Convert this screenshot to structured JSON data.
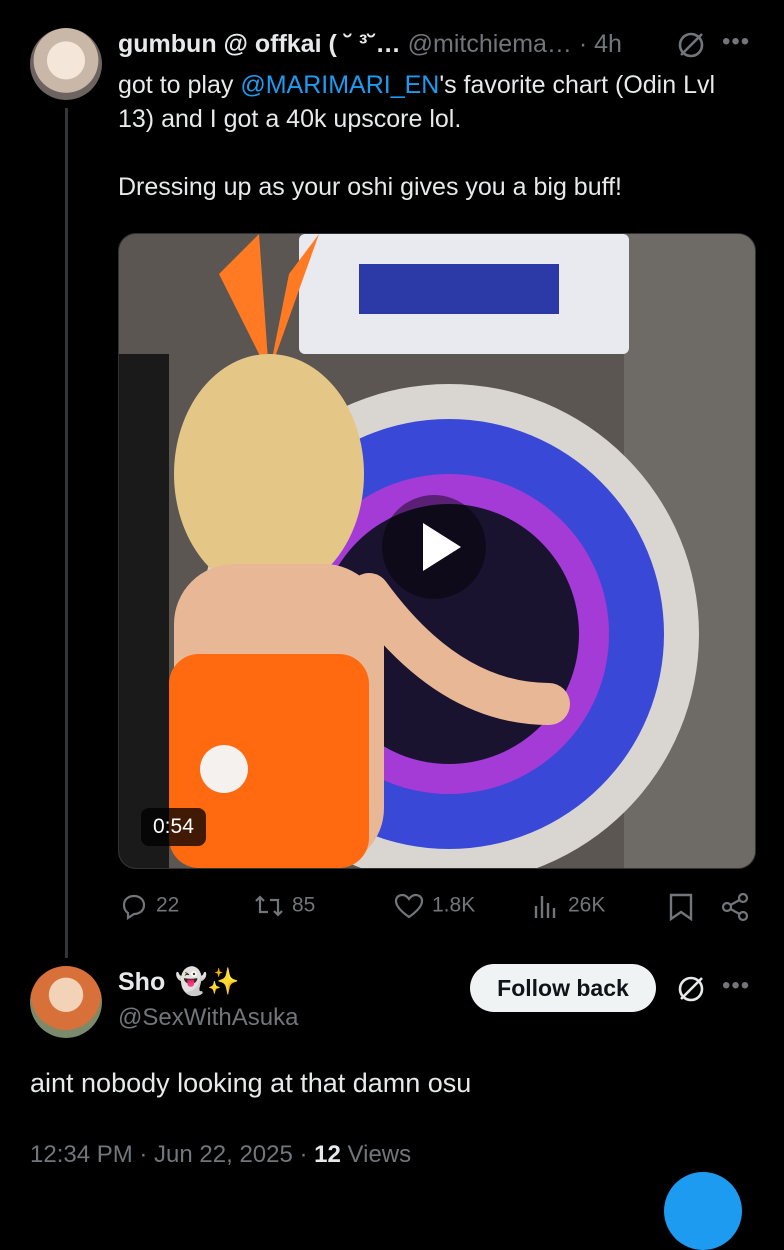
{
  "tweet": {
    "author_name": "gumbun @ offkai ( ˘ ³˘…",
    "handle": "@mitchiema…",
    "time": "· 4h",
    "text_pre": "got to play ",
    "mention": "@MARIMARI_EN",
    "text_post": "'s favorite chart (Odin Lvl 13) and I got a 40k upscore lol.",
    "text_para2": "Dressing up as your oshi gives you a big buff!",
    "video_duration": "0:54"
  },
  "actions": {
    "replies": "22",
    "reposts": "85",
    "likes": "1.8K",
    "views": "26K"
  },
  "reply": {
    "author_name": "Sho",
    "emoji": "👻✨",
    "handle": "@SexWithAsuka",
    "follow_label": "Follow back",
    "text": "aint nobody looking at that damn osu",
    "timestamp": "12:34 PM · Jun 22, 2025 ·",
    "views_count": "12",
    "views_label": "Views"
  },
  "colors": {
    "background": "#000000",
    "text": "#e7e9ea",
    "muted": "#71767b",
    "accent": "#1d9bf0"
  }
}
